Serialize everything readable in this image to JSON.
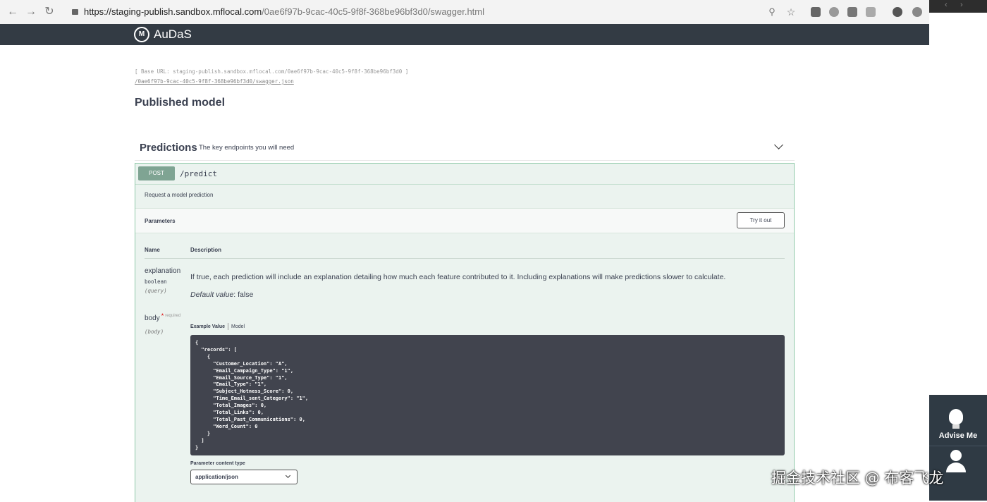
{
  "browser": {
    "url_host": "https://staging-publish.sandbox.mflocal.com",
    "url_path": "/0ae6f97b-9cac-40c5-9f8f-368be96bf3d0/swagger.html"
  },
  "app": {
    "logo_letter": "M",
    "name": "AuDaS"
  },
  "info": {
    "base_url": "[ Base URL: staging-publish.sandbox.mflocal.com/0ae6f97b-9cac-40c5-9f8f-368be96bf3d0 ]",
    "json_link": "/0ae6f97b-9cac-40c5-9f8f-368be96bf3d0/swagger.json",
    "title": "Published model"
  },
  "tag": {
    "name": "Predictions",
    "description": "The key endpoints you will need"
  },
  "operation": {
    "method": "POST",
    "path": "/predict",
    "summary": "Request a model prediction",
    "parameters_label": "Parameters",
    "try_button": "Try it out",
    "col_name": "Name",
    "col_description": "Description",
    "param1": {
      "name": "explanation",
      "type": "boolean",
      "in": "(query)",
      "description": "If true, each prediction will include an explanation detailing how much each feature contributed to it. Including explanations will make predictions slower to calculate.",
      "default_label": "Default value",
      "default_value": ": false"
    },
    "param2": {
      "name": "body",
      "star": "*",
      "required": "required",
      "in": "(body)",
      "tab_example": "Example Value",
      "tab_model": "Model",
      "example": "{\n  \"records\": [\n    {\n      \"Customer_Location\": \"A\",\n      \"Email_Campaign_Type\": \"1\",\n      \"Email_Source_Type\": \"1\",\n      \"Email_Type\": \"1\",\n      \"Subject_Hotness_Score\": 0,\n      \"Time_Email_sent_Category\": \"1\",\n      \"Total_Images\": 0,\n      \"Total_Links\": 0,\n      \"Total_Past_Communications\": 0,\n      \"Word_Count\": 0\n    }\n  ]\n}",
      "content_type_label": "Parameter content type",
      "content_type_value": "application/json"
    }
  },
  "widget": {
    "advise_label": "Advise Me"
  },
  "watermark": "掘金技术社区 @ 布客飞龙"
}
